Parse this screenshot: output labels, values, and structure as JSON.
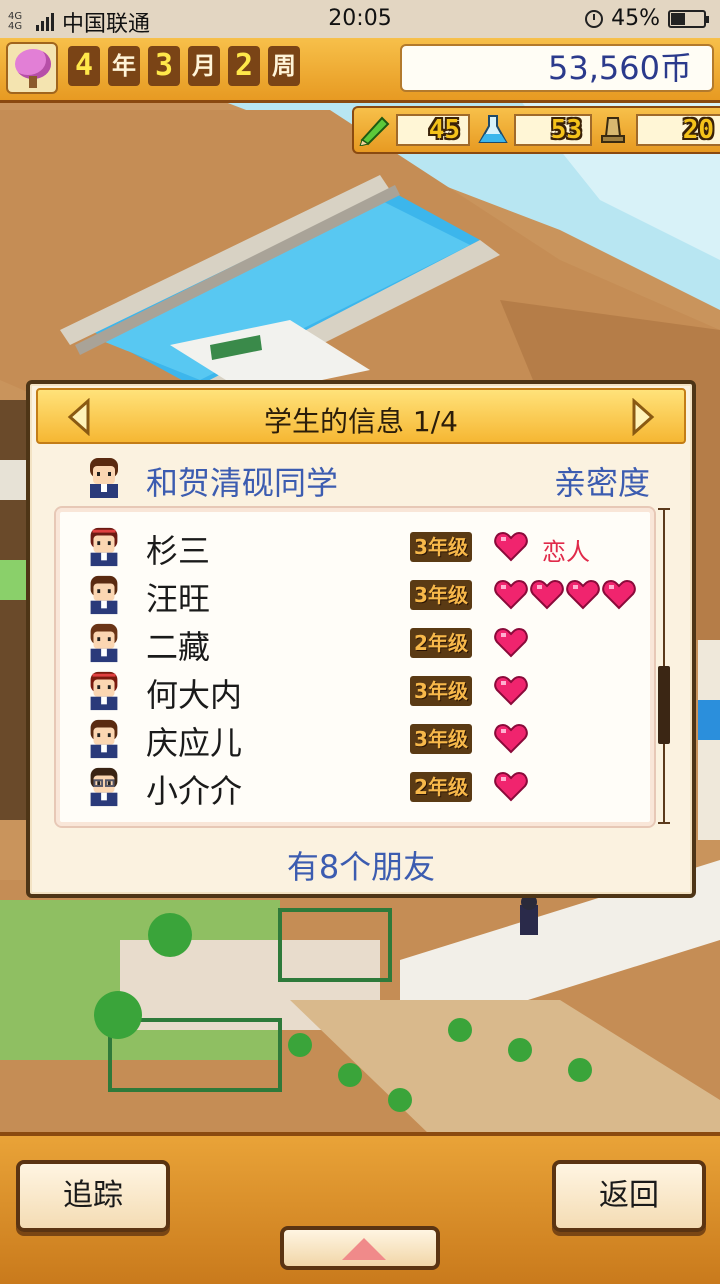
{
  "status_bar": {
    "network": "4G 4G",
    "carrier": "中国联通",
    "time": "20:05",
    "battery": "45%",
    "battery_level": 0.45
  },
  "hud": {
    "year": "4",
    "year_label": "年",
    "month": "3",
    "month_label": "月",
    "week": "2",
    "week_label": "周",
    "money": "53,560币",
    "stats": {
      "study": "45",
      "science": "53",
      "talent": "20"
    }
  },
  "dialog": {
    "title": "学生的信息 1/4",
    "student_name": "和贺清砚同学",
    "intimacy_label": "亲密度",
    "friends": [
      {
        "name": "杉三",
        "grade": "3年级",
        "hearts": 1,
        "relation": "恋人",
        "hair": "#6b1a12",
        "hairband": true
      },
      {
        "name": "汪旺",
        "grade": "3年级",
        "hearts": 4,
        "relation": "",
        "hair": "#5a2a10",
        "hairband": false
      },
      {
        "name": "二藏",
        "grade": "2年级",
        "hearts": 1,
        "relation": "",
        "hair": "#6a3416",
        "hairband": false
      },
      {
        "name": "何大内",
        "grade": "3年级",
        "hearts": 1,
        "relation": "",
        "hair": "#7a1a0e",
        "hairband": true
      },
      {
        "name": "庆应儿",
        "grade": "3年级",
        "hearts": 1,
        "relation": "",
        "hair": "#5a2a10",
        "hairband": false
      },
      {
        "name": "小介介",
        "grade": "2年级",
        "hearts": 1,
        "relation": "",
        "hair": "#3a2414",
        "hairband": false,
        "glasses": true
      }
    ],
    "friends_count": "有8个朋友"
  },
  "bottom_bar": {
    "track_label": "追踪",
    "back_label": "返回"
  },
  "colors": {
    "accent_blue": "#3c5cb0",
    "heart_pink": "#f0246e",
    "hud_orange": "#f0ad35"
  },
  "icons": {
    "pencil": "pencil-icon",
    "flask": "flask-icon",
    "trophy": "trophy-icon",
    "tree": "cherry-tree-icon"
  }
}
